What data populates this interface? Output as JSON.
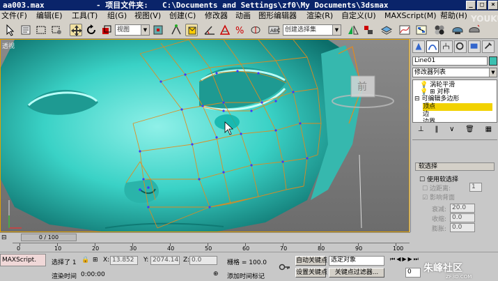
{
  "window": {
    "file": "aa003.max",
    "project_label": "- 项目文件夹:",
    "project_path": "C:\\Documents and Settings\\zf0\\My Documents\\3dsmax",
    "buttons": [
      "_",
      "□",
      "×"
    ]
  },
  "menu": [
    "文件(F)",
    "编辑(E)",
    "工具(T)",
    "组(G)",
    "视图(V)",
    "创建(C)",
    "修改器",
    "动画",
    "图形编辑器",
    "渲染(R)",
    "自定义(U)",
    "MAXScript(M)",
    "帮助(H)"
  ],
  "toolbar": {
    "ref_coord": "视图",
    "named_selection": "创建选择集"
  },
  "viewport": {
    "label": "透视",
    "viewcube_label": "前"
  },
  "command_panel": {
    "object_name": "Line01",
    "object_color": "#3cc0b0",
    "modifier_list": "修改器列表",
    "stack": [
      {
        "label": "涡轮平滑"
      },
      {
        "label": "对称"
      },
      {
        "label": "可编辑多边形"
      },
      {
        "label": "顶点",
        "selected": true
      },
      {
        "label": "边"
      },
      {
        "label": "边界"
      }
    ],
    "soft_selection": {
      "title": "软选择",
      "use_soft": "使用软选择",
      "edge_distance": "边距离:",
      "edge_distance_value": "1",
      "affect_backfacing": "影响背面",
      "falloff_label": "衰减:",
      "falloff_value": "20.0",
      "pinch_label": "收缩:",
      "pinch_value": "0.0",
      "bubble_label": "膨胀:",
      "bubble_value": "0.0"
    }
  },
  "timeline": {
    "frame_counter": "0 / 100",
    "ticks": [
      "0",
      "10",
      "20",
      "30",
      "40",
      "50",
      "60",
      "70",
      "80",
      "90",
      "100"
    ]
  },
  "status": {
    "maxscript": "MAXScript.",
    "selection_text": "选择了 1",
    "x_label": "X:",
    "x_value": "13.852",
    "y_label": "Y:",
    "y_value": "2074.142",
    "z_label": "Z:",
    "z_value": "0.0",
    "grid_label": "栅格 = 100.0",
    "render_time_label": "渲染时间",
    "render_time_value": "0:00:00",
    "add_time_tag": "添加时间标记",
    "auto_key": "自动关键点",
    "set_key": "设置关键点",
    "selected_object": "选定对象",
    "key_filters": "关键点过滤器...",
    "frame_value": "0"
  },
  "watermarks": {
    "youku": "YOUKU",
    "site": "朱峰社区",
    "site_url": "ZF3D.COM"
  }
}
